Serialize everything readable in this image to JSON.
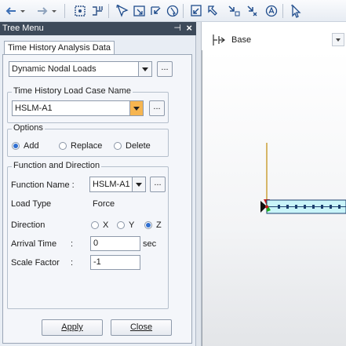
{
  "toolbar": {
    "icons": [
      "undo-icon",
      "redo-icon",
      "node-select-icon",
      "element-select-icon",
      "select-icon",
      "select-window-icon",
      "select-polygon-icon",
      "select-single-icon",
      "unselect-icon",
      "unselect-all-icon",
      "previous-select-icon",
      "query-icon"
    ]
  },
  "panel": {
    "title": "Tree Menu",
    "pin_glyph": "⊣",
    "close_glyph": "×",
    "tab_label": "Time History Analysis Data"
  },
  "form": {
    "type_select": "Dynamic Nodal Loads",
    "browse_label": "...",
    "load_case_group": "Time History Load Case Name",
    "load_case_value": "HSLM-A1",
    "options_group": "Options",
    "options": [
      {
        "label": "Add",
        "selected": true
      },
      {
        "label": "Replace",
        "selected": false
      },
      {
        "label": "Delete",
        "selected": false
      }
    ],
    "function_group": "Function and Direction",
    "function_name_label": "Function Name :",
    "function_name_value": "HSLM-A1",
    "load_type_label": "Load Type",
    "load_type_value": "Force",
    "direction_label": "Direction",
    "directions": [
      {
        "label": "X",
        "selected": false
      },
      {
        "label": "Y",
        "selected": false
      },
      {
        "label": "Z",
        "selected": true
      }
    ],
    "arrival_time_label": "Arrival Time",
    "arrival_time_colon": ":",
    "arrival_time_value": "0",
    "arrival_time_unit": "sec",
    "scale_factor_label": "Scale Factor",
    "scale_factor_colon": ":",
    "scale_factor_value": "-1",
    "apply_label": "Apply",
    "close_label": "Close"
  },
  "view": {
    "plane_label": "Base"
  },
  "colors": {
    "panel_title": "#3d4a5a",
    "accent_arrow": "#f6b550",
    "beam_fill": "#c9f4f9",
    "beam_edge": "#1c3f6e",
    "load_arrow": "#c89a2a"
  }
}
